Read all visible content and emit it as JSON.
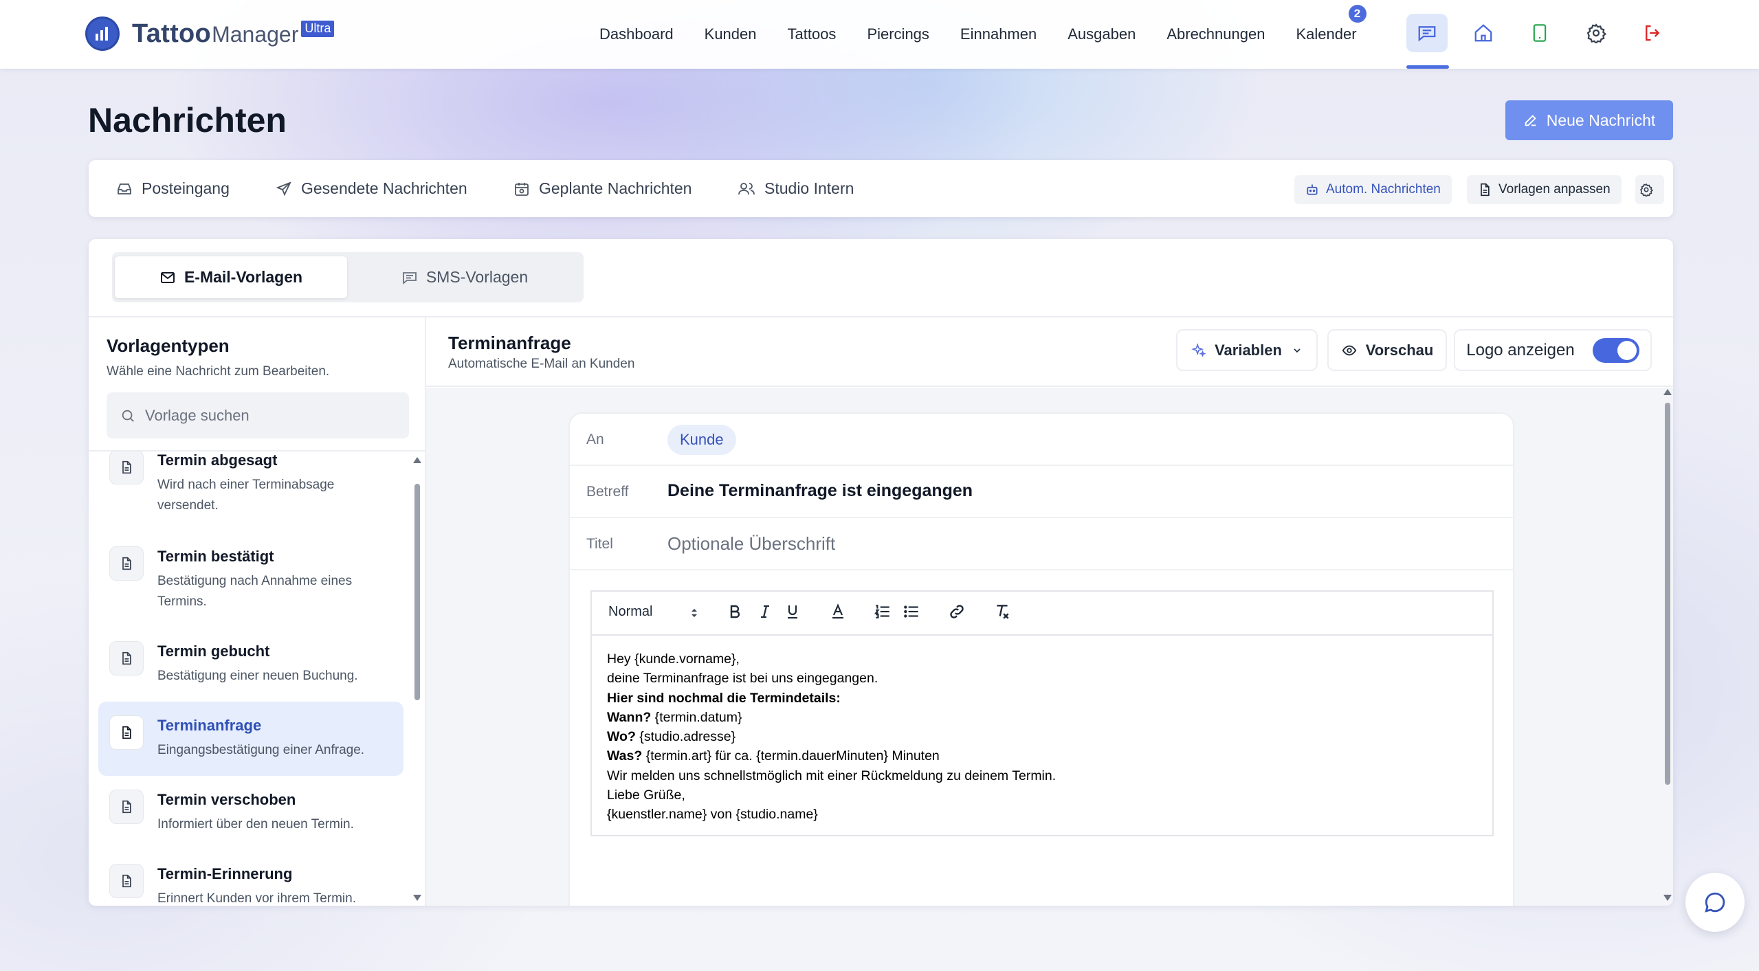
{
  "app": {
    "logo_part1": "Tattoo",
    "logo_part2": "Manager",
    "logo_badge": "Ultra"
  },
  "nav": {
    "links": [
      "Dashboard",
      "Kunden",
      "Tattoos",
      "Piercings",
      "Einnahmen",
      "Ausgaben",
      "Abrechnungen",
      "Kalender"
    ],
    "calendar_badge": "2",
    "icons": [
      "messages-icon",
      "home-icon",
      "tablet-icon",
      "gear-icon",
      "logout-icon"
    ]
  },
  "page": {
    "title": "Nachrichten",
    "new_message_label": "Neue Nachricht"
  },
  "tabs": {
    "items": [
      "Posteingang",
      "Gesendete Nachrichten",
      "Geplante Nachrichten",
      "Studio Intern"
    ],
    "auto_messages_label": "Autom. Nachrichten",
    "customize_templates_label": "Vorlagen anpassen"
  },
  "segment": {
    "email_label": "E-Mail-Vorlagen",
    "sms_label": "SMS-Vorlagen"
  },
  "sidebar": {
    "title": "Vorlagentypen",
    "subtitle": "Wähle eine Nachricht zum Bearbeiten.",
    "search_placeholder": "Vorlage suchen",
    "items": [
      {
        "name": "Termin abgesagt",
        "desc": "Wird nach einer Terminabsage versendet."
      },
      {
        "name": "Termin bestätigt",
        "desc": "Bestätigung nach Annahme eines Termins."
      },
      {
        "name": "Termin gebucht",
        "desc": "Bestätigung einer neuen Buchung."
      },
      {
        "name": "Terminanfrage",
        "desc": "Eingangsbestätigung einer Anfrage."
      },
      {
        "name": "Termin verschoben",
        "desc": "Informiert über den neuen Termin."
      },
      {
        "name": "Termin-Erinnerung",
        "desc": "Erinnert Kunden vor ihrem Termin."
      }
    ]
  },
  "editor": {
    "template_title": "Terminanfrage",
    "template_subtitle": "Automatische E-Mail an Kunden",
    "variables_label": "Variablen",
    "preview_label": "Vorschau",
    "logo_toggle_label": "Logo anzeigen",
    "logo_toggle_on": true,
    "to_label": "An",
    "to_value": "Kunde",
    "subject_label": "Betreff",
    "subject_value": "Deine Terminanfrage ist eingegangen",
    "title_label": "Titel",
    "title_placeholder": "Optionale Überschrift",
    "format_select": "Normal",
    "body": {
      "line1": "Hey {kunde.vorname},",
      "line2": "deine Terminanfrage ist bei uns eingegangen.",
      "line3": "Hier sind nochmal die Termindetails:",
      "line4_bold": "Wann?",
      "line4_rest": " {termin.datum}",
      "line5_bold": "Wo?",
      "line5_rest": " {studio.adresse}",
      "line6_bold": "Was?",
      "line6_rest": " {termin.art} für ca. {termin.dauerMinuten} Minuten",
      "line7": "Wir melden uns schnellstmöglich mit einer Rückmeldung zu deinem Termin.",
      "line8": "Liebe Grüße,",
      "line9": "{kuenstler.name} von {studio.name}"
    }
  },
  "colors": {
    "accent": "#4667dd",
    "primary_button": "#6f90ef",
    "selected_item_bg": "#e6edfc"
  }
}
